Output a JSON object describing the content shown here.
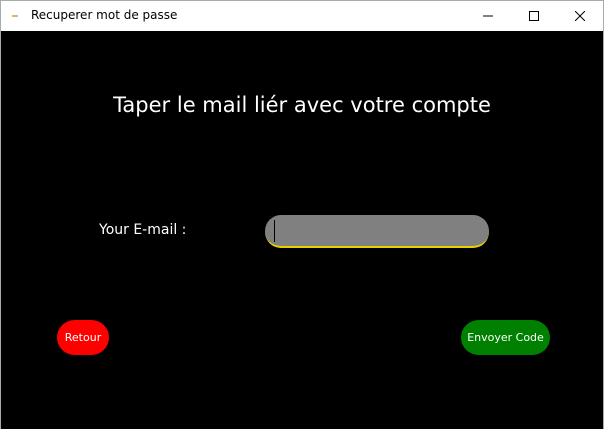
{
  "window": {
    "title": "Recuperer mot de passe",
    "controls": {
      "minimize_icon": "minimize-icon",
      "maximize_icon": "maximize-icon",
      "close_icon": "close-icon"
    }
  },
  "main": {
    "heading": "Taper le mail liér avec votre compte",
    "email_label": "Your E-mail :",
    "email_value": "",
    "back_button": "Retour",
    "send_button": "Envoyer Code"
  },
  "colors": {
    "background": "#000000",
    "input_fill": "#808080",
    "input_underline": "#e6d000",
    "back_button": "#ff0000",
    "send_button": "#008000",
    "text": "#ffffff"
  }
}
